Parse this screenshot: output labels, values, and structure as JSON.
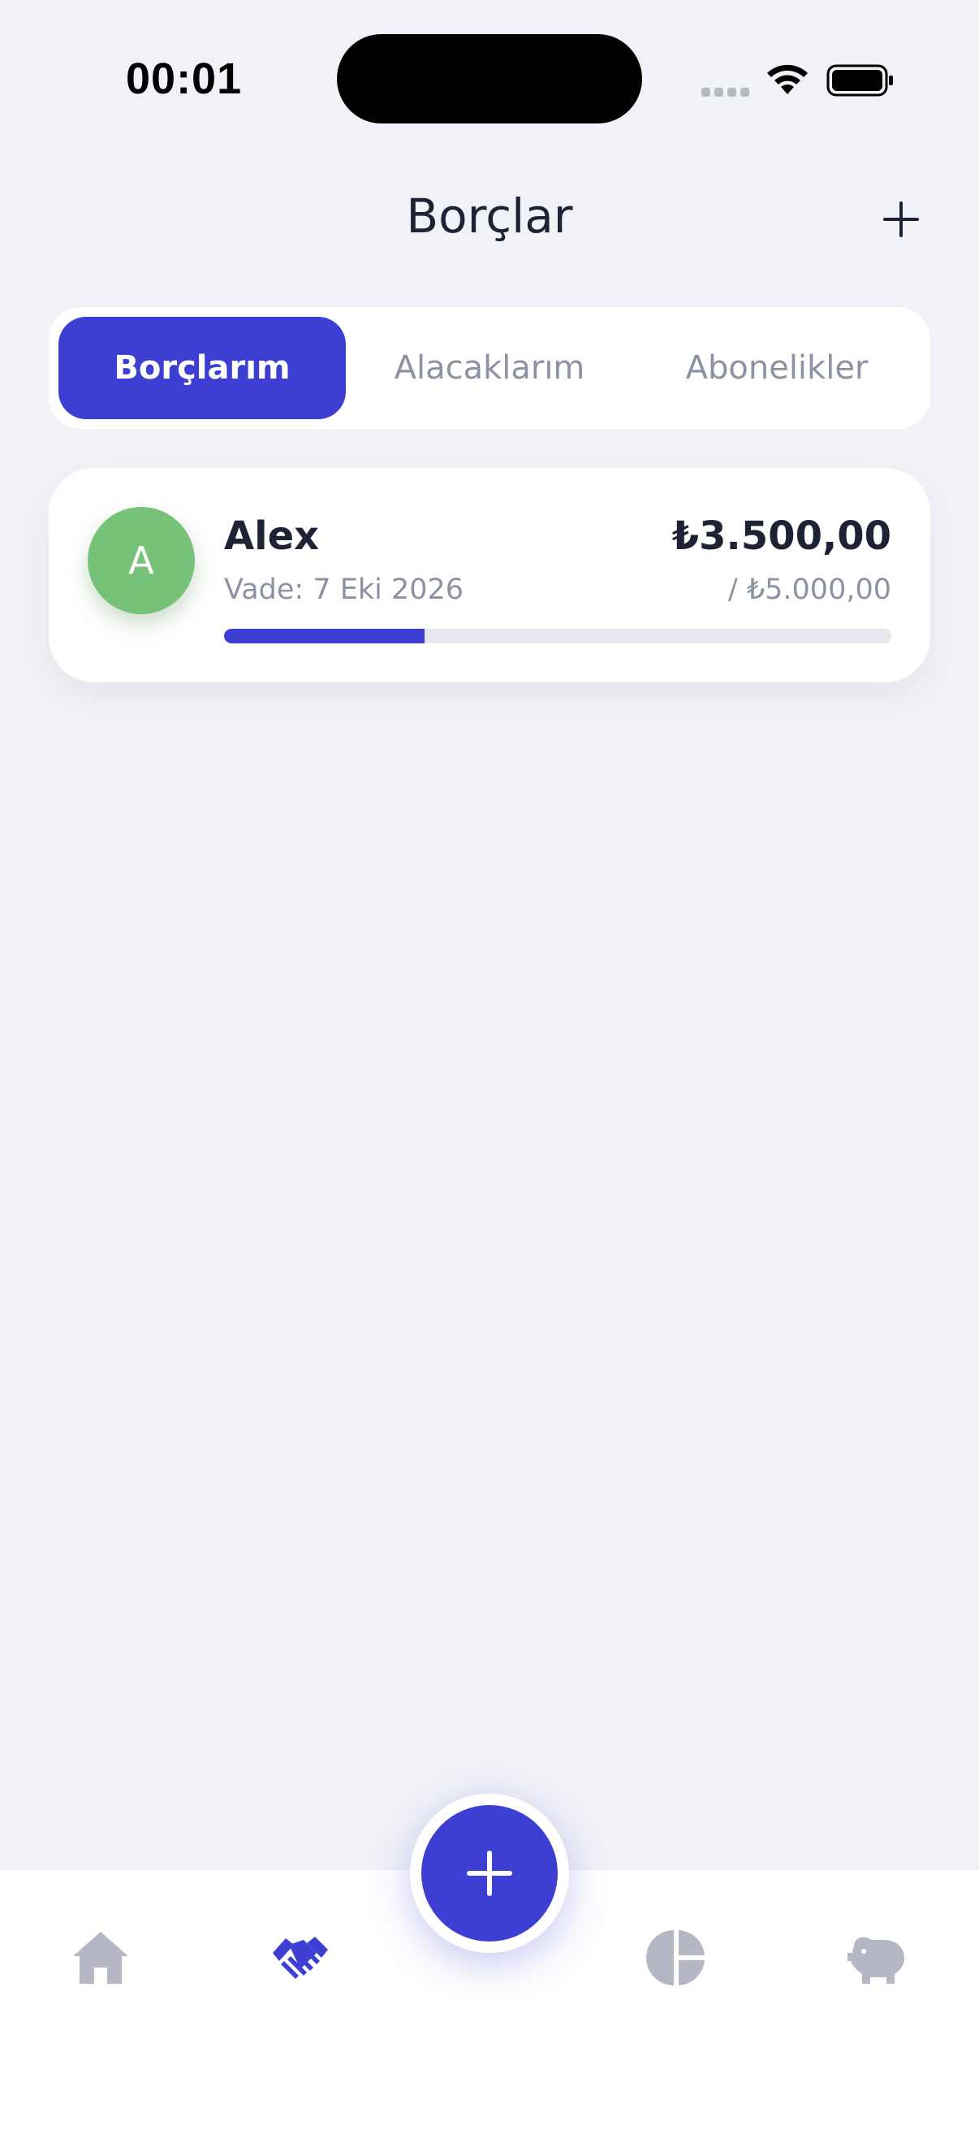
{
  "status_bar": {
    "time": "00:01"
  },
  "header": {
    "title": "Borçlar",
    "add_icon": "plus-icon"
  },
  "tabs": [
    {
      "label": "Borçlarım",
      "active": true
    },
    {
      "label": "Alacaklarım",
      "active": false
    },
    {
      "label": "Abonelikler",
      "active": false
    }
  ],
  "debts": [
    {
      "avatar_initial": "A",
      "avatar_color": "#75c278",
      "name": "Alex",
      "due": "Vade: 7 Eki 2026",
      "amount": "₺3.500,00",
      "total": "/ ₺5.000,00",
      "progress_fraction": 0.3
    }
  ],
  "bottom_nav": {
    "items": [
      {
        "icon": "home-icon",
        "active": false
      },
      {
        "icon": "handshake-icon",
        "active": true
      },
      {
        "icon": "pie-chart-icon",
        "active": false
      },
      {
        "icon": "piggy-bank-icon",
        "active": false
      }
    ],
    "fab_icon": "plus-icon"
  },
  "colors": {
    "accent": "#3c3fd1",
    "background": "#f1f2f7",
    "muted_text": "#8c92a3",
    "inactive_icon": "#b5b8c4"
  }
}
